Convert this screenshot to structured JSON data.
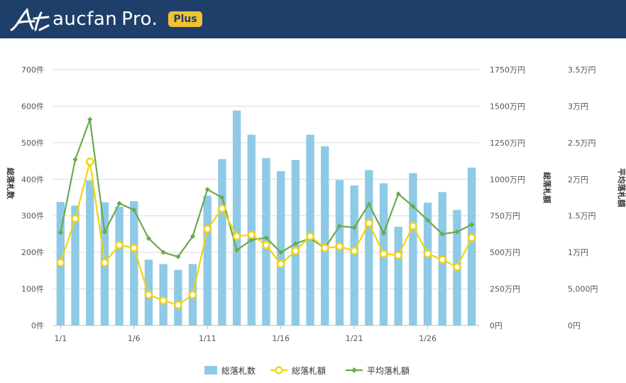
{
  "header": {
    "brand_name": "aucfan",
    "brand_suffix": "Pro.",
    "badge": "Plus",
    "logo_icon": "aucfan-logo-icon",
    "background": "#1f3f6b",
    "badge_color": "#f1c232"
  },
  "chart_data": {
    "type": "bar",
    "x": [
      "1/1",
      "1/2",
      "1/3",
      "1/4",
      "1/5",
      "1/6",
      "1/7",
      "1/8",
      "1/9",
      "1/10",
      "1/11",
      "1/12",
      "1/13",
      "1/14",
      "1/15",
      "1/16",
      "1/17",
      "1/18",
      "1/19",
      "1/20",
      "1/21",
      "1/22",
      "1/23",
      "1/24",
      "1/25",
      "1/26",
      "1/27",
      "1/28",
      "1/29"
    ],
    "x_tick_labels": [
      "1/1",
      "1/6",
      "1/11",
      "1/16",
      "1/21",
      "1/26"
    ],
    "series": [
      {
        "name": "総落札数",
        "kind": "bar",
        "axis": "left",
        "color": "#8ecae6",
        "values": [
          338,
          328,
          397,
          337,
          325,
          340,
          180,
          168,
          152,
          168,
          355,
          455,
          588,
          522,
          458,
          422,
          453,
          522,
          490,
          398,
          383,
          425,
          389,
          270,
          417,
          336,
          365,
          316,
          432
        ]
      },
      {
        "name": "総落札額",
        "kind": "line",
        "axis": "right1",
        "color": "#f2d40c",
        "values": [
          4300000,
          7300000,
          11200000,
          4300000,
          5500000,
          5300000,
          2100000,
          1700000,
          1400000,
          2100000,
          6600000,
          8000000,
          6100000,
          6200000,
          5500000,
          4200000,
          5100000,
          6100000,
          5300000,
          5400000,
          5100000,
          7000000,
          4900000,
          4800000,
          6800000,
          4900000,
          4500000,
          4000000,
          6000000
        ]
      },
      {
        "name": "平均落札額",
        "kind": "line",
        "axis": "right2",
        "color": "#6aaa4f",
        "values": [
          12700,
          22700,
          28200,
          12800,
          16700,
          15800,
          11900,
          10000,
          9400,
          12200,
          18600,
          17500,
          10300,
          11700,
          12000,
          10000,
          11200,
          11900,
          10600,
          13600,
          13400,
          16600,
          12600,
          18000,
          16300,
          14400,
          12500,
          12800,
          13800
        ]
      }
    ],
    "axes": {
      "left": {
        "label": "総落札数",
        "ylim": [
          0,
          700
        ],
        "ticks": [
          "0件",
          "100件",
          "200件",
          "300件",
          "400件",
          "500件",
          "600件",
          "700件"
        ]
      },
      "right1": {
        "label": "総落札額",
        "ylim": [
          0,
          17500000
        ],
        "ticks": [
          "0円",
          "250万円",
          "500万円",
          "750万円",
          "1000万円",
          "1250万円",
          "1500万円",
          "1750万円"
        ]
      },
      "right2": {
        "label": "平均落札額",
        "ylim": [
          0,
          35000
        ],
        "ticks": [
          "0円",
          "5,000円",
          "1万円",
          "1.5万円",
          "2万円",
          "2.5万円",
          "3万円",
          "3.5万円"
        ]
      }
    },
    "grid": true,
    "legend_position": "bottom-center",
    "legend": [
      "総落札数",
      "総落札額",
      "平均落札額"
    ]
  }
}
